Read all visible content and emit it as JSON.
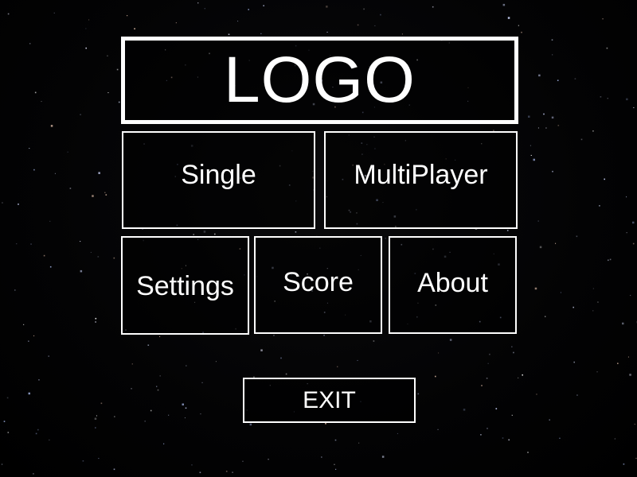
{
  "logo": {
    "text": "LOGO"
  },
  "menu": {
    "single_label": "Single",
    "multiplayer_label": "MultiPlayer",
    "settings_label": "Settings",
    "score_label": "Score",
    "about_label": "About",
    "exit_label": "EXIT"
  },
  "colors": {
    "background": "#000000",
    "border": "#ffffff",
    "text": "#ffffff"
  }
}
